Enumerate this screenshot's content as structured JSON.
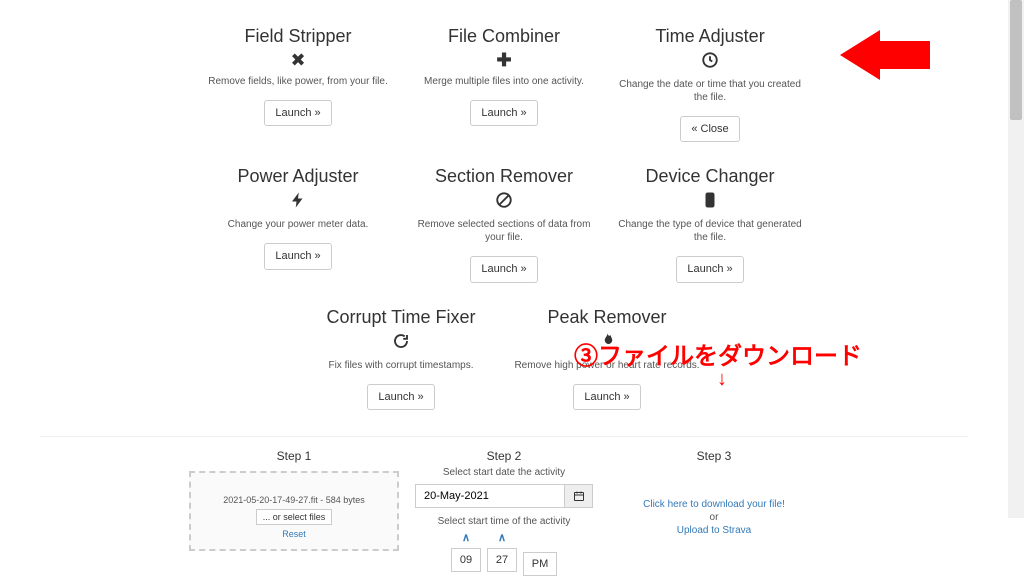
{
  "tools": [
    {
      "title": "Field Stripper",
      "desc": "Remove fields, like power, from your file.",
      "btn": "Launch »",
      "icon": "close"
    },
    {
      "title": "File Combiner",
      "desc": "Merge multiple files into one activity.",
      "btn": "Launch »",
      "icon": "plus"
    },
    {
      "title": "Time Adjuster",
      "desc": "Change the date or time that you created the file.",
      "btn": "« Close",
      "icon": "clock"
    },
    {
      "title": "Power Adjuster",
      "desc": "Change your power meter data.",
      "btn": "Launch »",
      "icon": "bolt"
    },
    {
      "title": "Section Remover",
      "desc": "Remove selected sections of data from your file.",
      "btn": "Launch »",
      "icon": "ban"
    },
    {
      "title": "Device Changer",
      "desc": "Change the type of device that generated the file.",
      "btn": "Launch »",
      "icon": "phone"
    },
    {
      "title": "Corrupt Time Fixer",
      "desc": "Fix files with corrupt timestamps.",
      "btn": "Launch »",
      "icon": "refresh"
    },
    {
      "title": "Peak Remover",
      "desc": "Remove high power or heart rate records.",
      "btn": "Launch »",
      "icon": "flame"
    }
  ],
  "steps": {
    "step1": {
      "heading": "Step 1",
      "file_meta": "2021-05-20-17-49-27.fit - 584 bytes",
      "or_select": "... or select files",
      "reset": "Reset"
    },
    "step2": {
      "heading": "Step 2",
      "caption_date": "Select start date the activity",
      "date_value": "20-May-2021",
      "caption_time": "Select start time of the activity",
      "hour": "09",
      "minute": "27",
      "ampm": "PM"
    },
    "step3": {
      "heading": "Step 3",
      "download": "Click here to download your file!",
      "or": "or",
      "strava": "Upload to Strava"
    }
  },
  "annotation": {
    "jp_text": "③ファイルをダウンロード",
    "down_arrow": "↓"
  }
}
